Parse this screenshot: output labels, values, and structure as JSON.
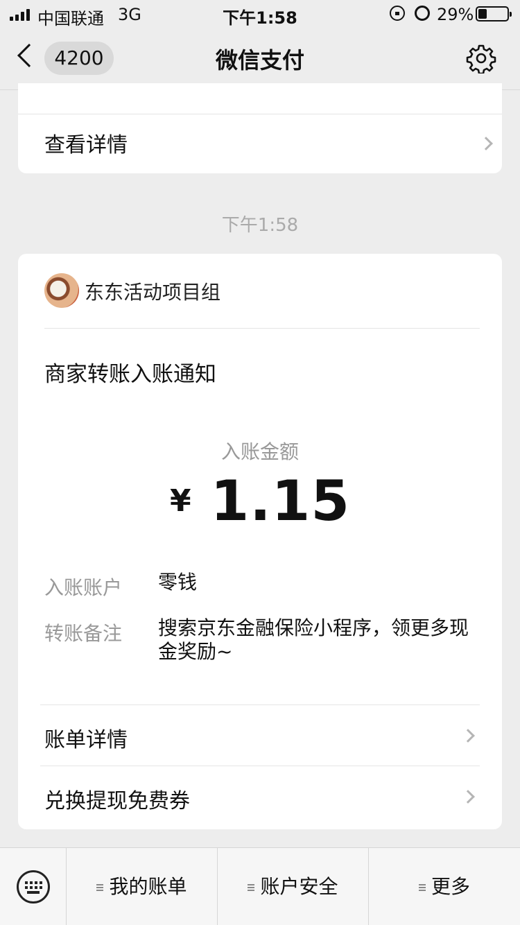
{
  "status_bar": {
    "carrier": "中国联通",
    "network": "3G",
    "time": "下午1:58",
    "battery": "29%",
    "battery_level": 0.29
  },
  "nav": {
    "unread_count": "4200",
    "title": "微信支付"
  },
  "prev_card": {
    "details_label": "查看详情"
  },
  "timestamp": "下午1:58",
  "message": {
    "sender": "东东活动项目组",
    "title": "商家转账入账通知",
    "amount_label": "入账金额",
    "currency": "¥",
    "amount": "1.15",
    "account_label": "入账账户",
    "account_value": "零钱",
    "remark_label": "转账备注",
    "remark_value": "搜索京东金融保险小程序，领更多现金奖励~",
    "bill_details": "账单详情",
    "coupon": "兑换提现免费券"
  },
  "toolbar": {
    "items": [
      {
        "label": "我的账单"
      },
      {
        "label": "账户安全"
      },
      {
        "label": "更多"
      }
    ]
  }
}
